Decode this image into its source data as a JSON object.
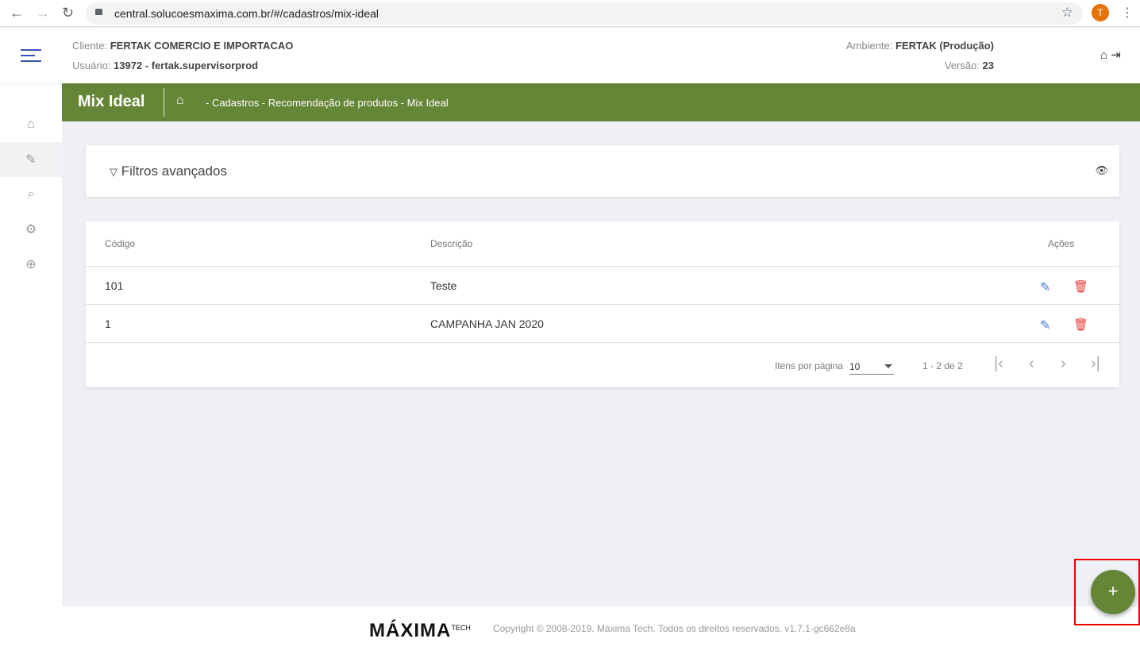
{
  "browser": {
    "url": "central.solucoesmaxima.com.br/#/cadastros/mix-ideal",
    "avatar": "T"
  },
  "header": {
    "cliente_label": "Cliente:",
    "cliente": "FERTAK COMERCIO E IMPORTACAO",
    "usuario_label": "Usuário:",
    "usuario": "13972 - fertak.supervisorprod",
    "ambiente_label": "Ambiente:",
    "ambiente": "FERTAK (Produção)",
    "versao_label": "Versão:",
    "versao": "23"
  },
  "page": {
    "title": "Mix Ideal",
    "breadcrumb": "- Cadastros - Recomendação de produtos - Mix Ideal"
  },
  "filter": {
    "title": "Filtros avançados"
  },
  "table": {
    "columns": [
      "Código",
      "Descrição",
      "Ações"
    ],
    "rows": [
      {
        "codigo": "101",
        "descricao": "Teste"
      },
      {
        "codigo": "1",
        "descricao": "CAMPANHA JAN 2020"
      }
    ]
  },
  "pagination": {
    "items_label": "Itens por página",
    "per_page": "10",
    "range": "1 - 2 de 2"
  },
  "footer": {
    "logo": "máxima TECH",
    "copyright": "Copyright © 2008-2019. Máxima Tech. Todos os direitos reservados. v1.7.1-gc662e8a"
  },
  "fab": {
    "label": "+"
  },
  "colors": {
    "primary": "#658637",
    "edit": "#4a78d6",
    "delete": "#e53935"
  }
}
